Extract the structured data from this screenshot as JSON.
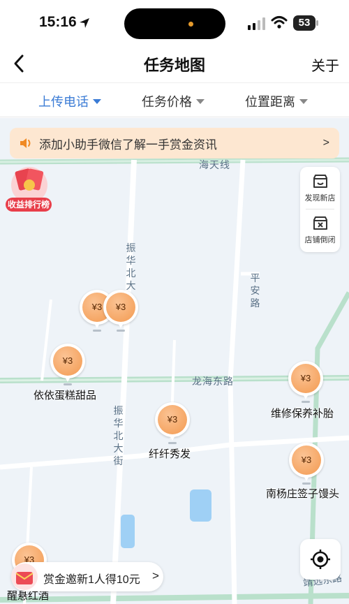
{
  "status_bar": {
    "time": "15:16",
    "battery": "53"
  },
  "header": {
    "back_icon": "chevron-left-icon",
    "title": "任务地图",
    "about": "关于"
  },
  "filters": [
    {
      "label": "上传电话",
      "active": true
    },
    {
      "label": "任务价格",
      "active": false
    },
    {
      "label": "位置距离",
      "active": false
    }
  ],
  "notice": {
    "text": "添加小助手微信了解一手赏金资讯",
    "arrow": ">"
  },
  "rank": {
    "label": "收益排行榜"
  },
  "tools": [
    {
      "label": "发现新店",
      "icon": "store-icon"
    },
    {
      "label": "店铺倒闭",
      "icon": "store-closed-icon"
    }
  ],
  "roads": {
    "haitian": "海天线",
    "zhenhua_top": "振华北大",
    "ping_an": "平安路",
    "longhai": "龙海东路",
    "zhenhua_bottom": "振华北大街",
    "jingyuan": "靖远东路"
  },
  "pins": [
    {
      "price": "¥3"
    },
    {
      "price": "¥3"
    },
    {
      "price": "¥3"
    },
    {
      "price": "¥3"
    },
    {
      "price": "¥3"
    },
    {
      "price": "¥3"
    },
    {
      "price": "¥3"
    }
  ],
  "pois": {
    "cake": "依依蛋糕甜品",
    "repair": "维修保养补胎",
    "hair": "纤纤秀发",
    "mantou": "南杨庄签子馒头",
    "wine": "醒悬红酒"
  },
  "invite": {
    "text": "赏金邀新1人得10元",
    "arrow": ">"
  },
  "colors": {
    "accent": "#3a7bd5",
    "pin": "#f39a50",
    "notice_bg": "#fde7d1",
    "rank": "#e83e4a",
    "road_green": "#b8dcc8"
  }
}
